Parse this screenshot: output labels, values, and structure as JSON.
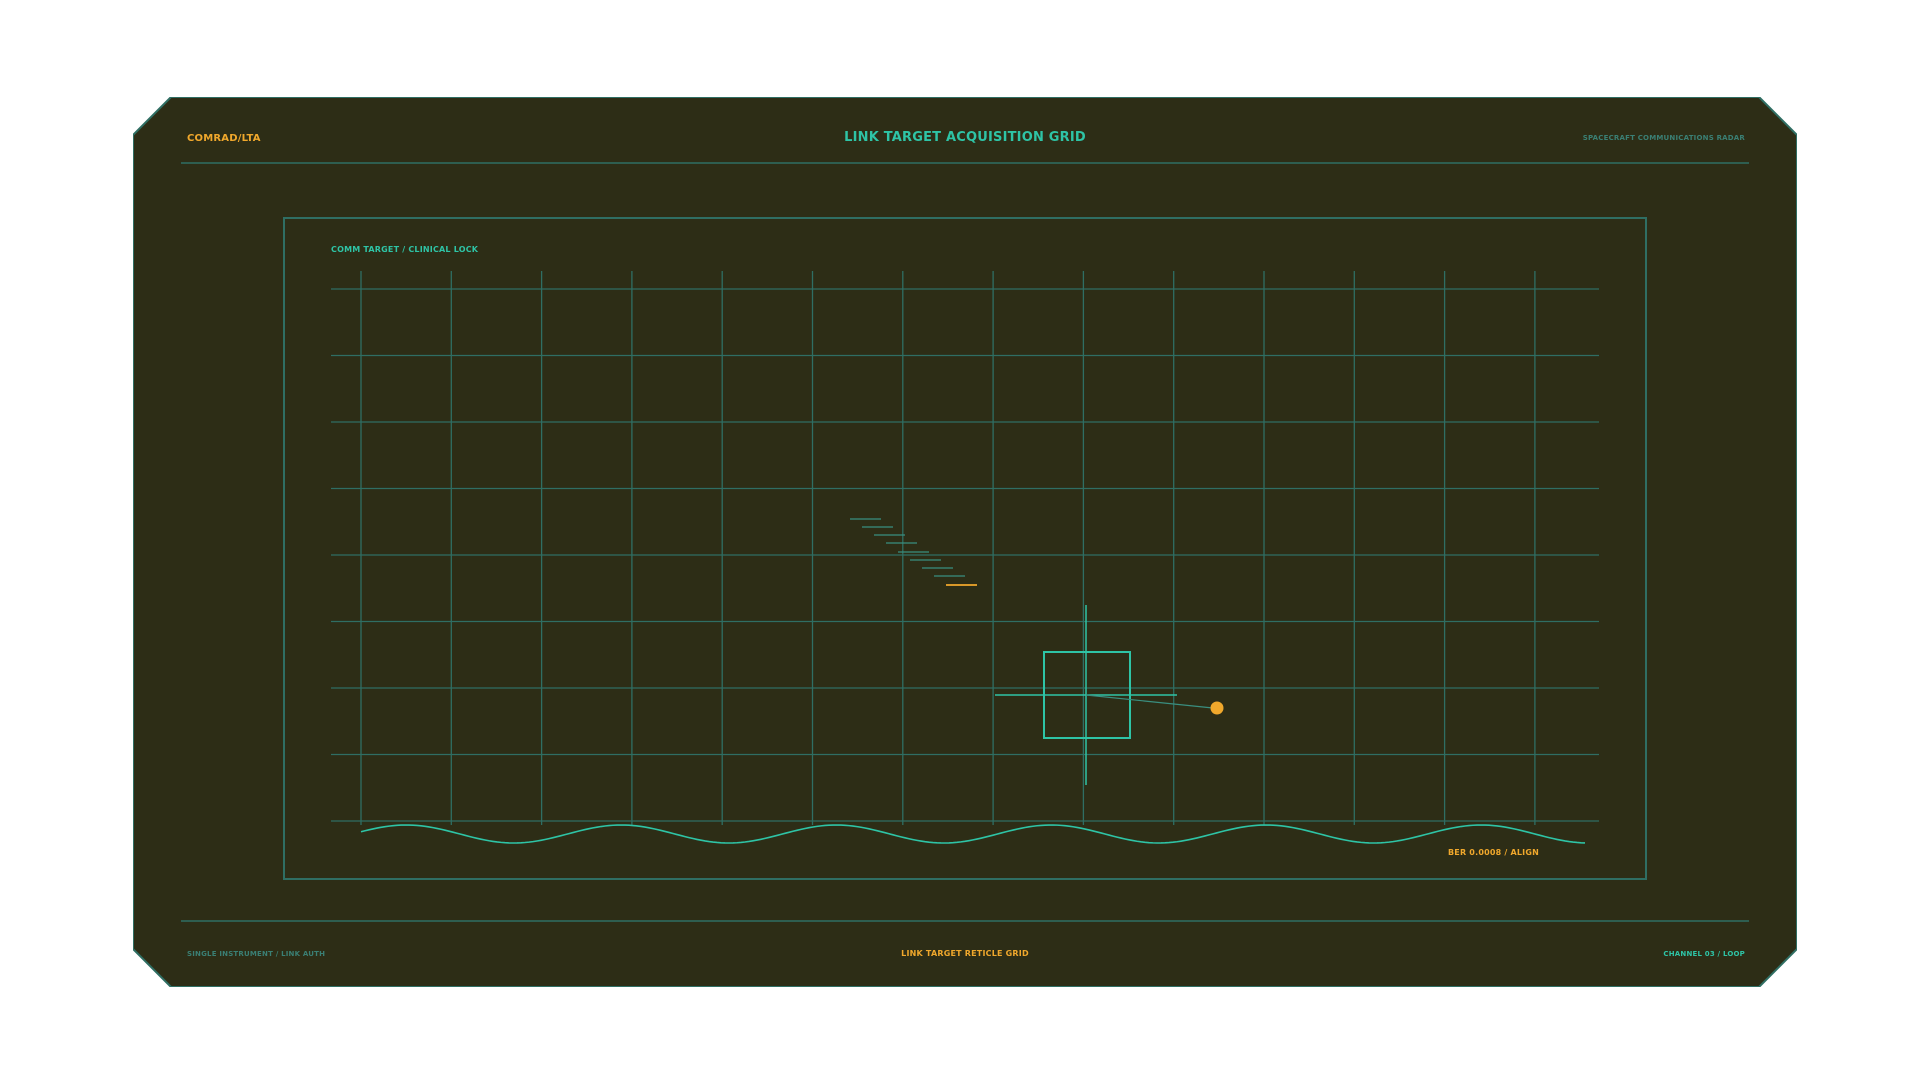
{
  "window": {
    "code": "COMRAD/LTA",
    "title": "LINK TARGET ACQUISITION GRID",
    "subtitle": "SPACECRAFT COMMUNICATIONS RADAR"
  },
  "panel": {
    "label": "COMM TARGET / CLINICAL LOCK",
    "readout": "BER 0.0008 / ALIGN"
  },
  "footer": {
    "left": "SINGLE INSTRUMENT / LINK AUTH",
    "center": "LINK TARGET RETICLE GRID",
    "right": "CHANNEL 03 / LOOP"
  },
  "colors": {
    "background": "#2d2d16",
    "grid": "#2f6e63",
    "accent_teal": "#2ec4a6",
    "accent_orange": "#f0a82c",
    "muted_teal": "#3a7f74"
  },
  "icons": {
    "reticle": "target-reticle-icon",
    "target_dot": "target-dot-icon"
  }
}
